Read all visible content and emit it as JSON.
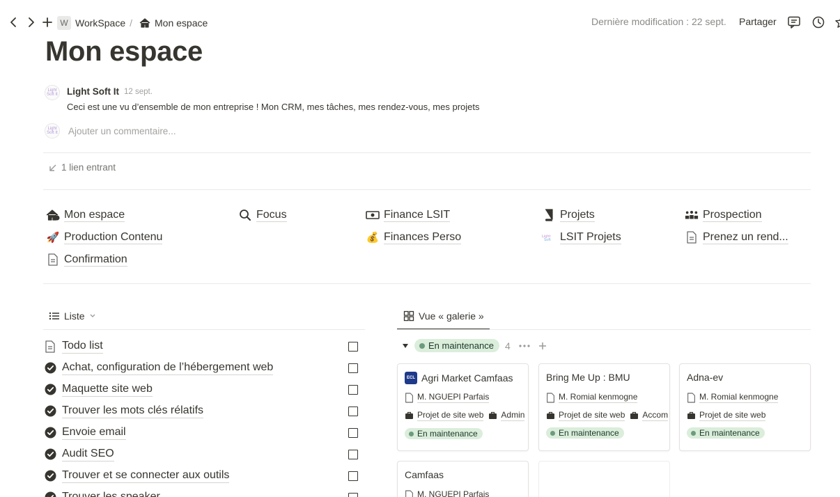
{
  "breadcrumb": {
    "workspace_badge": "W",
    "workspace": "WorkSpace",
    "separator": "/",
    "page": "Mon espace"
  },
  "topbar": {
    "last_modified": "Dernière modification : 22 sept.",
    "share": "Partager"
  },
  "page_title": "Mon espace",
  "comment": {
    "author": "Light Soft It",
    "date": "12 sept.",
    "text": "Ceci est une vu d’ensemble de mon entreprise ! Mon CRM, mes tâches, mes rendez-vous, mes projets",
    "input_placeholder": "Ajouter un commentaire...",
    "avatar_text": "Light Soft It"
  },
  "backlinks": "1 lien entrant",
  "links": [
    {
      "label": "Mon espace",
      "icon": "house-icon"
    },
    {
      "label": "Focus",
      "icon": "search-icon"
    },
    {
      "label": "Finance LSIT",
      "icon": "money-icon"
    },
    {
      "label": "Projets",
      "icon": "book-icon"
    },
    {
      "label": "Prospection",
      "icon": "people-icon"
    },
    {
      "label": "Production Contenu",
      "icon": "rocket-icon"
    },
    {
      "label": "Finances Perso",
      "icon": "money-bag-icon"
    },
    {
      "label": "LSIT Projets",
      "icon": "logo-icon"
    },
    {
      "label": "Prenez un rend...",
      "icon": "page-icon"
    },
    {
      "label": "Confirmation",
      "icon": "page-icon"
    }
  ],
  "list_view": {
    "tab_label": "Liste",
    "items": [
      {
        "label": "Todo list",
        "icon": "page-icon"
      },
      {
        "label": "Achat, configuration de l’hébergement web",
        "icon": "check-circle-icon"
      },
      {
        "label": "Maquette site web",
        "icon": "check-circle-icon"
      },
      {
        "label": "Trouver les mots clés rélatifs",
        "icon": "check-circle-icon"
      },
      {
        "label": "Envoie email",
        "icon": "check-circle-icon"
      },
      {
        "label": "Audit SEO",
        "icon": "check-circle-icon"
      },
      {
        "label": "Trouver et se connecter aux outils",
        "icon": "check-circle-icon"
      },
      {
        "label": "Trouver les speaker",
        "icon": "check-circle-icon"
      }
    ]
  },
  "gallery_view": {
    "tab_label": "Vue « galerie »",
    "group": {
      "label": "En maintenance",
      "count": "4",
      "color": "#dbeddb"
    },
    "cards": [
      {
        "title": "Agri Market Camfaas",
        "owner": "M. NGUEPI Parfais",
        "tag1": "Projet de site web",
        "tag2": "Admin",
        "status": "En maintenance",
        "logo": "ECL"
      },
      {
        "title": "Bring Me Up : BMU",
        "owner": "M. Romial kenmogne",
        "tag1": "Projet de site web",
        "tag2": "Accom",
        "status": "En maintenance"
      },
      {
        "title": "Adna-ev",
        "owner": "M. Romial kenmogne",
        "tag1": "Projet de site web",
        "status": "En maintenance"
      },
      {
        "title": "Camfaas",
        "owner": "M. NGUEPI Parfais"
      }
    ]
  }
}
